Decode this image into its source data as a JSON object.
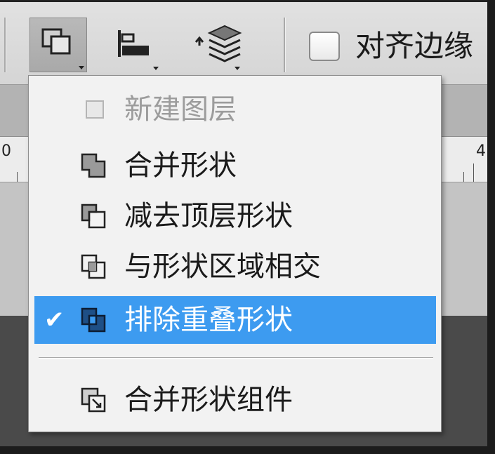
{
  "toolbar": {
    "path_ops_button_icon": "path-operations-icon",
    "path_align_icon": "path-alignment-icon",
    "path_arrange_icon": "path-arrangement-icon",
    "align_edges_label": "对齐边缘",
    "align_edges_checked": false
  },
  "ruler": {
    "left_number": "0",
    "right_number": "4"
  },
  "menu": {
    "items": [
      {
        "label": "新建图层",
        "icon": "new-layer-icon",
        "disabled": true,
        "selected": false
      },
      {
        "label": "合并形状",
        "icon": "combine-shapes-icon",
        "disabled": false,
        "selected": false
      },
      {
        "label": "减去顶层形状",
        "icon": "subtract-front-shape-icon",
        "disabled": false,
        "selected": false
      },
      {
        "label": "与形状区域相交",
        "icon": "intersect-shape-areas-icon",
        "disabled": false,
        "selected": false
      },
      {
        "label": "排除重叠形状",
        "icon": "exclude-overlapping-shapes-icon",
        "disabled": false,
        "selected": true
      },
      {
        "label": "合并形状组件",
        "icon": "merge-shape-components-icon",
        "disabled": false,
        "selected": false
      }
    ],
    "check_mark": "✔"
  },
  "colors": {
    "selection": "#3d9bf0",
    "menu_bg": "#f2f2f2",
    "toolbar_bg": "#d9d9d9"
  }
}
